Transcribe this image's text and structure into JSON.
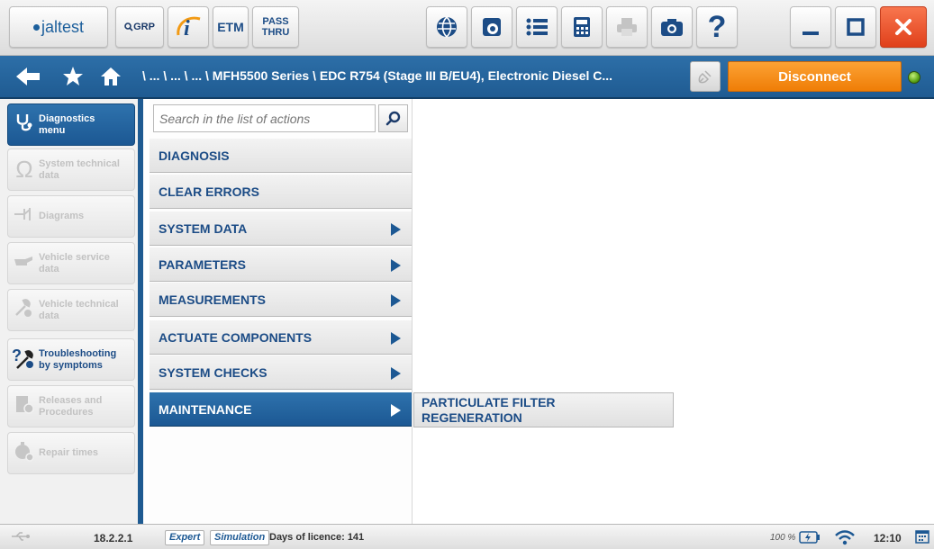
{
  "toolbar": {
    "logo_text": "jaltest",
    "grp_label": "GRP",
    "info_label": "i",
    "etm_label": "ETM",
    "pass_label_1": "PASS",
    "pass_label_2": "THRU"
  },
  "nav": {
    "path": "\\ ... \\ ... \\ ... \\ MFH5500 Series \\ EDC R754 (Stage III B/EU4), Electronic Diesel C...",
    "disconnect_label": "Disconnect"
  },
  "sidebar": {
    "items": [
      {
        "label_1": "Diagnostics",
        "label_2": "menu",
        "icon": "stethoscope-icon"
      },
      {
        "label_1": "System technical",
        "label_2": "data",
        "icon": "omega-icon"
      },
      {
        "label_1": "Diagrams",
        "label_2": "",
        "icon": "diagram-icon"
      },
      {
        "label_1": "Vehicle service",
        "label_2": "data",
        "icon": "oil-can-icon"
      },
      {
        "label_1": "Vehicle technical",
        "label_2": "data",
        "icon": "wrench-gear-icon"
      },
      {
        "label_1": "Troubleshooting",
        "label_2": "by symptoms",
        "icon": "troubleshoot-icon"
      },
      {
        "label_1": "Releases and",
        "label_2": "Procedures",
        "icon": "procedures-icon"
      },
      {
        "label_1": "Repair times",
        "label_2": "",
        "icon": "stopwatch-icon"
      }
    ]
  },
  "menu": {
    "search_placeholder": "Search in the list of actions",
    "items": [
      {
        "label": "DIAGNOSIS"
      },
      {
        "label": "CLEAR ERRORS"
      },
      {
        "label": "SYSTEM DATA"
      },
      {
        "label": "PARAMETERS"
      },
      {
        "label": "MEASUREMENTS"
      },
      {
        "label": "ACTUATE COMPONENTS"
      },
      {
        "label": "SYSTEM CHECKS"
      },
      {
        "label": "MAINTENANCE"
      }
    ],
    "submenu": {
      "line_1": "PARTICULATE FILTER",
      "line_2": "REGENERATION"
    }
  },
  "status": {
    "version": "18.2.2.1",
    "expert_label": "Expert",
    "simulation_label": "Simulation",
    "licence": "Days of licence: 141",
    "zoom": "100 %",
    "time": "12:10"
  },
  "colors": {
    "accent_blue": "#1f5b92",
    "disconnect_orange": "#f5900f",
    "close_red": "#e8502a",
    "status_green": "#5ca517"
  }
}
